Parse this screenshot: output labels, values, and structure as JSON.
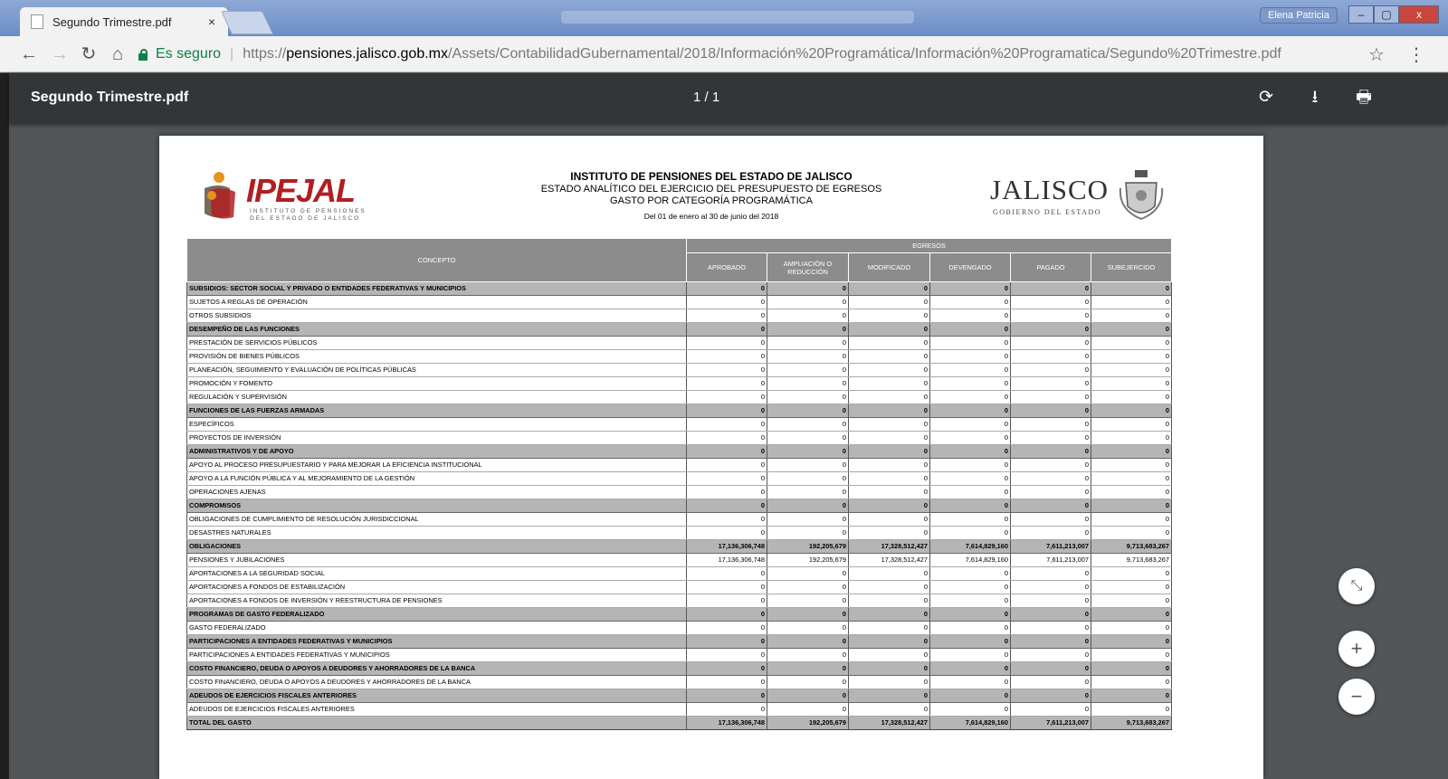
{
  "browser": {
    "tab_title": "Segundo Trimestre.pdf",
    "tab_close": "×",
    "user_name": "Elena Patricia",
    "window_buttons": [
      "–",
      "▢",
      "x"
    ],
    "secure_label": "Es seguro",
    "url_scheme": "https://",
    "url_host": "pensiones.jalisco.gob.mx",
    "url_path": "/Assets/ContabilidadGubernamental/2018/Información%20Programática/Información%20Programatica/Segundo%20Trimestre.pdf",
    "icons": [
      "back-arrow-icon",
      "forward-arrow-icon",
      "reload-icon",
      "home-icon",
      "lock-icon",
      "star-icon",
      "menu-icon"
    ]
  },
  "pdf_viewer": {
    "title": "Segundo Trimestre.pdf",
    "page_indicator": "1 / 1",
    "icons": [
      "rotate-icon",
      "download-icon",
      "print-icon",
      "fit-page-icon",
      "zoom-in-icon",
      "zoom-out-icon"
    ]
  },
  "document": {
    "logo_left": "IPEJAL",
    "logo_left_sub1": "INSTITUTO DE PENSIONES",
    "logo_left_sub2": "DEL ESTADO DE JALISCO",
    "title": "INSTITUTO DE PENSIONES DEL ESTADO DE JALISCO",
    "subtitle1": "ESTADO ANALÍTICO DEL EJERCICIO DEL PRESUPUESTO DE EGRESOS",
    "subtitle2": "GASTO POR CATEGORÍA PROGRAMÁTICA",
    "period": "Del 01 de enero al 30 de junio del 2018",
    "logo_right": "JALISCO",
    "logo_right_sub": "GOBIERNO DEL ESTADO",
    "table": {
      "concept_header": "CONCEPTO",
      "group_header": "EGRESOS",
      "columns": [
        "APROBADO",
        "AMPLIACIÓN O REDUCCIÓN",
        "MODIFICADO",
        "DEVENGADO",
        "PAGADO",
        "SUBEJERCIDO"
      ],
      "rows": [
        {
          "type": "cat",
          "label": "SUBSIDIOS: SECTOR SOCIAL Y PRIVADO O ENTIDADES FEDERATIVAS Y MUNICIPIOS",
          "values": [
            "0",
            "0",
            "0",
            "0",
            "0",
            "0"
          ]
        },
        {
          "type": "item",
          "label": "SUJETOS A REGLAS DE OPERACIÓN",
          "values": [
            "0",
            "0",
            "0",
            "0",
            "0",
            "0"
          ]
        },
        {
          "type": "item",
          "label": "OTROS SUBSIDIOS",
          "values": [
            "0",
            "0",
            "0",
            "0",
            "0",
            "0"
          ]
        },
        {
          "type": "cat",
          "label": "DESEMPEÑO DE LAS FUNCIONES",
          "values": [
            "0",
            "0",
            "0",
            "0",
            "0",
            "0"
          ]
        },
        {
          "type": "item",
          "label": "PRESTACIÓN DE SERVICIOS PÚBLICOS",
          "values": [
            "0",
            "0",
            "0",
            "0",
            "0",
            "0"
          ]
        },
        {
          "type": "item",
          "label": "PROVISIÓN DE BIENES PÚBLICOS",
          "values": [
            "0",
            "0",
            "0",
            "0",
            "0",
            "0"
          ]
        },
        {
          "type": "item",
          "label": "PLANEACIÓN, SEGUIMIENTO Y EVALUACIÓN DE POLÍTICAS PÚBLICAS",
          "values": [
            "0",
            "0",
            "0",
            "0",
            "0",
            "0"
          ]
        },
        {
          "type": "item",
          "label": "PROMOCIÓN Y FOMENTO",
          "values": [
            "0",
            "0",
            "0",
            "0",
            "0",
            "0"
          ]
        },
        {
          "type": "item",
          "label": "REGULACIÓN Y SUPERVISIÓN",
          "values": [
            "0",
            "0",
            "0",
            "0",
            "0",
            "0"
          ]
        },
        {
          "type": "cat",
          "label": "FUNCIONES DE LAS FUERZAS ARMADAS",
          "values": [
            "0",
            "0",
            "0",
            "0",
            "0",
            "0"
          ]
        },
        {
          "type": "item",
          "label": "ESPECÍFICOS",
          "values": [
            "0",
            "0",
            "0",
            "0",
            "0",
            "0"
          ]
        },
        {
          "type": "item",
          "label": "PROYECTOS DE INVERSIÓN",
          "values": [
            "0",
            "0",
            "0",
            "0",
            "0",
            "0"
          ]
        },
        {
          "type": "cat",
          "label": "ADMINISTRATIVOS Y DE APOYO",
          "values": [
            "0",
            "0",
            "0",
            "0",
            "0",
            "0"
          ]
        },
        {
          "type": "item",
          "label": "APOYO AL PROCESO PRESUPUESTARIO Y PARA MEJORAR LA EFICIENCIA INSTITUCIONAL",
          "values": [
            "0",
            "0",
            "0",
            "0",
            "0",
            "0"
          ]
        },
        {
          "type": "item",
          "label": "APOYO A LA FUNCIÓN PÚBLICA Y AL MEJORAMIENTO DE LA GESTIÓN",
          "values": [
            "0",
            "0",
            "0",
            "0",
            "0",
            "0"
          ]
        },
        {
          "type": "item",
          "label": "OPERACIONES AJENAS",
          "values": [
            "0",
            "0",
            "0",
            "0",
            "0",
            "0"
          ]
        },
        {
          "type": "cat",
          "label": "COMPROMISOS",
          "values": [
            "0",
            "0",
            "0",
            "0",
            "0",
            "0"
          ]
        },
        {
          "type": "item",
          "label": "OBLIGACIONES DE CUMPLIMIENTO DE RESOLUCIÓN JURISDICCIONAL",
          "values": [
            "0",
            "0",
            "0",
            "0",
            "0",
            "0"
          ]
        },
        {
          "type": "item",
          "label": "DESASTRES NATURALES",
          "values": [
            "0",
            "0",
            "0",
            "0",
            "0",
            "0"
          ]
        },
        {
          "type": "cat",
          "label": "OBLIGACIONES",
          "values": [
            "17,136,306,748",
            "192,205,679",
            "17,328,512,427",
            "7,614,829,160",
            "7,611,213,007",
            "9,713,683,267"
          ]
        },
        {
          "type": "item",
          "label": "PENSIONES Y JUBILACIONES",
          "values": [
            "17,136,306,748",
            "192,205,679",
            "17,328,512,427",
            "7,614,829,160",
            "7,611,213,007",
            "9,713,683,267"
          ]
        },
        {
          "type": "item",
          "label": "APORTACIONES A LA SEGURIDAD SOCIAL",
          "values": [
            "0",
            "0",
            "0",
            "0",
            "0",
            "0"
          ]
        },
        {
          "type": "item",
          "label": "APORTACIONES A FONDOS DE ESTABILIZACIÓN",
          "values": [
            "0",
            "0",
            "0",
            "0",
            "0",
            "0"
          ]
        },
        {
          "type": "item",
          "label": "APORTACIONES A FONDOS DE INVERSIÓN Y REESTRUCTURA DE PENSIONES",
          "values": [
            "0",
            "0",
            "0",
            "0",
            "0",
            "0"
          ]
        },
        {
          "type": "cat",
          "label": "PROGRAMAS DE GASTO FEDERALIZADO",
          "values": [
            "0",
            "0",
            "0",
            "0",
            "0",
            "0"
          ]
        },
        {
          "type": "item",
          "label": "GASTO FEDERALIZADO",
          "values": [
            "0",
            "0",
            "0",
            "0",
            "0",
            "0"
          ]
        },
        {
          "type": "cat",
          "label": "PARTICIPACIONES A ENTIDADES FEDERATIVAS Y MUNICIPIOS",
          "values": [
            "0",
            "0",
            "0",
            "0",
            "0",
            "0"
          ]
        },
        {
          "type": "item",
          "label": "PARTICIPACIONES A ENTIDADES FEDERATIVAS Y MUNICIPIOS",
          "values": [
            "0",
            "0",
            "0",
            "0",
            "0",
            "0"
          ]
        },
        {
          "type": "cat",
          "label": "COSTO FINANCIERO, DEUDA O APOYOS A DEUDORES Y AHORRADORES DE LA BANCA",
          "values": [
            "0",
            "0",
            "0",
            "0",
            "0",
            "0"
          ]
        },
        {
          "type": "item",
          "label": "COSTO FINANCIERO, DEUDA O APOYOS A DEUDORES Y AHORRADORES DE LA BANCA",
          "values": [
            "0",
            "0",
            "0",
            "0",
            "0",
            "0"
          ]
        },
        {
          "type": "cat",
          "label": "ADEUDOS DE EJERCICIOS FISCALES ANTERIORES",
          "values": [
            "0",
            "0",
            "0",
            "0",
            "0",
            "0"
          ]
        },
        {
          "type": "item",
          "label": "ADEUDOS DE EJERCICIOS FISCALES ANTERIORES",
          "values": [
            "0",
            "0",
            "0",
            "0",
            "0",
            "0"
          ]
        },
        {
          "type": "total",
          "label": "TOTAL DEL GASTO",
          "values": [
            "17,136,306,748",
            "192,205,679",
            "17,328,512,427",
            "7,614,829,160",
            "7,611,213,007",
            "9,713,683,267"
          ]
        }
      ]
    }
  }
}
